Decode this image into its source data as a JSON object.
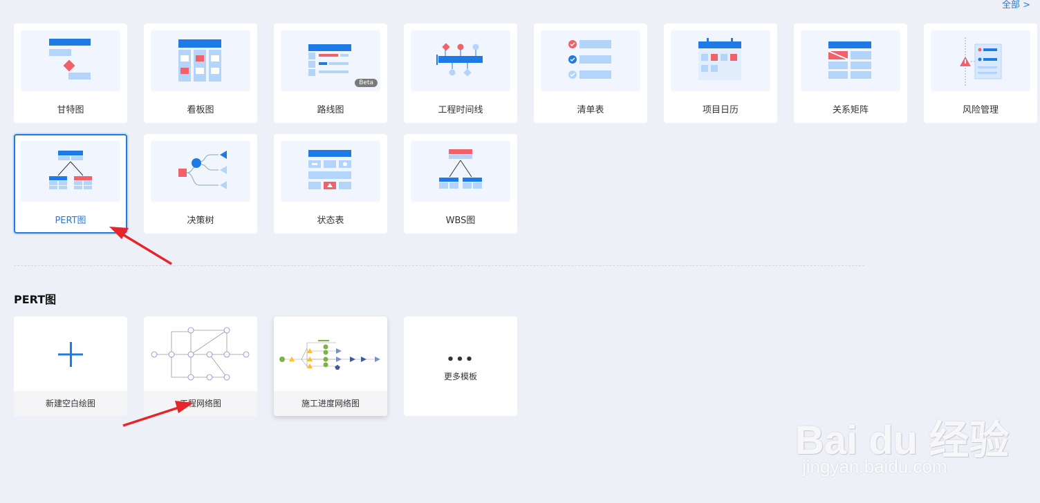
{
  "header": {
    "all_link": "全部 >"
  },
  "types": [
    {
      "label": "甘特图",
      "icon": "gantt-icon"
    },
    {
      "label": "看板图",
      "icon": "kanban-icon"
    },
    {
      "label": "路线图",
      "icon": "roadmap-icon",
      "badge": "Beta"
    },
    {
      "label": "工程时间线",
      "icon": "timeline-icon"
    },
    {
      "label": "清单表",
      "icon": "checklist-icon"
    },
    {
      "label": "项目日历",
      "icon": "calendar-icon"
    },
    {
      "label": "关系矩阵",
      "icon": "matrix-icon"
    },
    {
      "label": "风险管理",
      "icon": "risk-icon"
    },
    {
      "label": "PERT图",
      "icon": "pert-icon",
      "selected": true
    },
    {
      "label": "决策树",
      "icon": "decision-tree-icon"
    },
    {
      "label": "状态表",
      "icon": "status-table-icon"
    },
    {
      "label": "WBS图",
      "icon": "wbs-icon"
    }
  ],
  "section": {
    "title": "PERT图"
  },
  "templates": [
    {
      "label": "新建空白绘图"
    },
    {
      "label": "工程网络图"
    },
    {
      "label": "施工进度网络图"
    },
    {
      "label": "更多模板",
      "dots": "•••"
    }
  ],
  "watermark": {
    "main": "Bai du 经验",
    "sub": "jingyan.baidu.com"
  },
  "colors": {
    "accent": "#1e7be6",
    "red": "#f0616a",
    "light_blue": "#b3d5fb",
    "background": "#eef0f7"
  }
}
